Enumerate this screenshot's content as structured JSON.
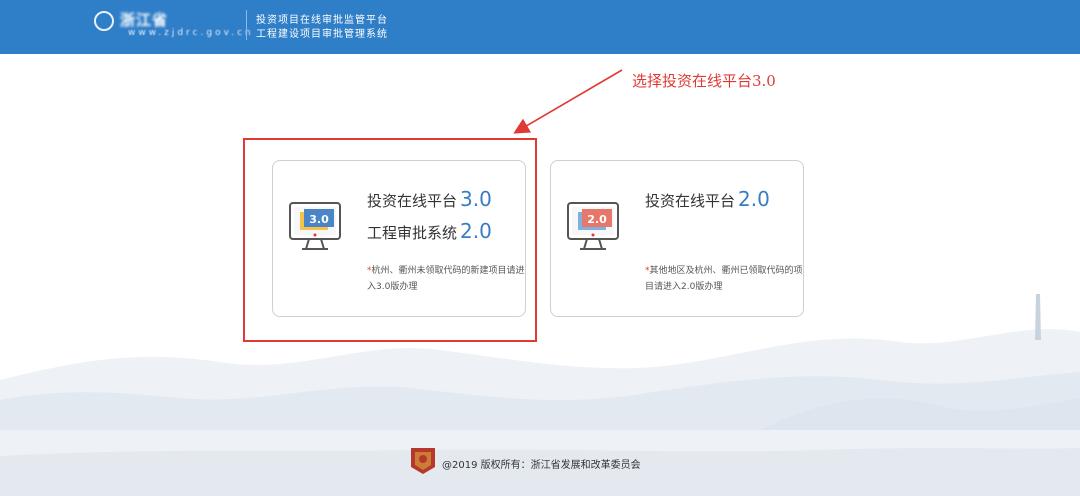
{
  "header": {
    "logo_name": "浙江省",
    "logo_url": "www.zjdrc.gov.cn",
    "line1": "投资项目在线审批监管平台",
    "line2": "工程建设项目审批管理系统"
  },
  "annotation": {
    "text": "选择投资在线平台3.0"
  },
  "cards": [
    {
      "icon_label": "3.0",
      "title1": "投资在线平台",
      "title1_ver": "3.0",
      "title2": "工程审批系统",
      "title2_ver": "2.0",
      "note_star": "*",
      "note": "杭州、衢州未领取代码的新建项目请进入3.0版办理"
    },
    {
      "icon_label": "2.0",
      "title1": "投资在线平台",
      "title1_ver": "2.0",
      "note_star": "*",
      "note": "其他地区及杭州、衢州已领取代码的项目请进入2.0版办理"
    }
  ],
  "footer": {
    "text": "@2019  版权所有：浙江省发展和改革委员会"
  },
  "colors": {
    "header": "#2f7ec8",
    "accent": "#3a7cc3",
    "highlight": "#e03a34"
  }
}
